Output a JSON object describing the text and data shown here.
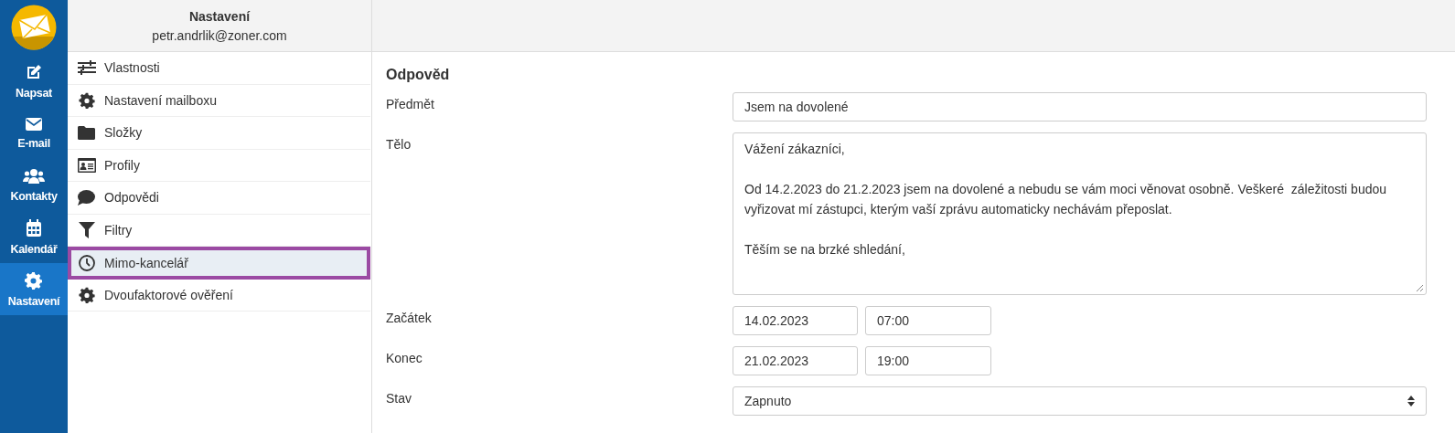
{
  "rail": {
    "items": [
      {
        "label": "Napsat",
        "selected": false
      },
      {
        "label": "E-mail",
        "selected": false
      },
      {
        "label": "Kontakty",
        "selected": false
      },
      {
        "label": "Kalendář",
        "selected": false
      },
      {
        "label": "Nastavení",
        "selected": true
      }
    ]
  },
  "settings": {
    "title": "Nastavení",
    "account": "petr.andrlik@zoner.com",
    "items": [
      {
        "label": "Vlastnosti",
        "selected": false
      },
      {
        "label": "Nastavení mailboxu",
        "selected": false
      },
      {
        "label": "Složky",
        "selected": false
      },
      {
        "label": "Profily",
        "selected": false
      },
      {
        "label": "Odpovědi",
        "selected": false
      },
      {
        "label": "Filtry",
        "selected": false
      },
      {
        "label": "Mimo-kancelář",
        "selected": true
      },
      {
        "label": "Dvoufaktorové ověření",
        "selected": false
      }
    ]
  },
  "form": {
    "title": "Odpověd",
    "subject": {
      "label": "Předmět",
      "value": "Jsem na dovolené"
    },
    "body": {
      "label": "Tělo",
      "paragraphs": [
        "Vážení zákazníci,",
        "Od 14.2.2023 do 21.2.2023 jsem na dovolené a nebudu se vám moci věnovat osobně. Veškeré  záležitosti budou vyřizovat mí zástupci, kterým vaší zprávu automaticky nechávám přeposlat.",
        "Těším se na brzké shledání,"
      ]
    },
    "start": {
      "label": "Začátek",
      "date": "14.02.2023",
      "time": "07:00"
    },
    "end": {
      "label": "Konec",
      "date": "21.02.2023",
      "time": "19:00"
    },
    "status": {
      "label": "Stav",
      "value": "Zapnuto"
    }
  }
}
